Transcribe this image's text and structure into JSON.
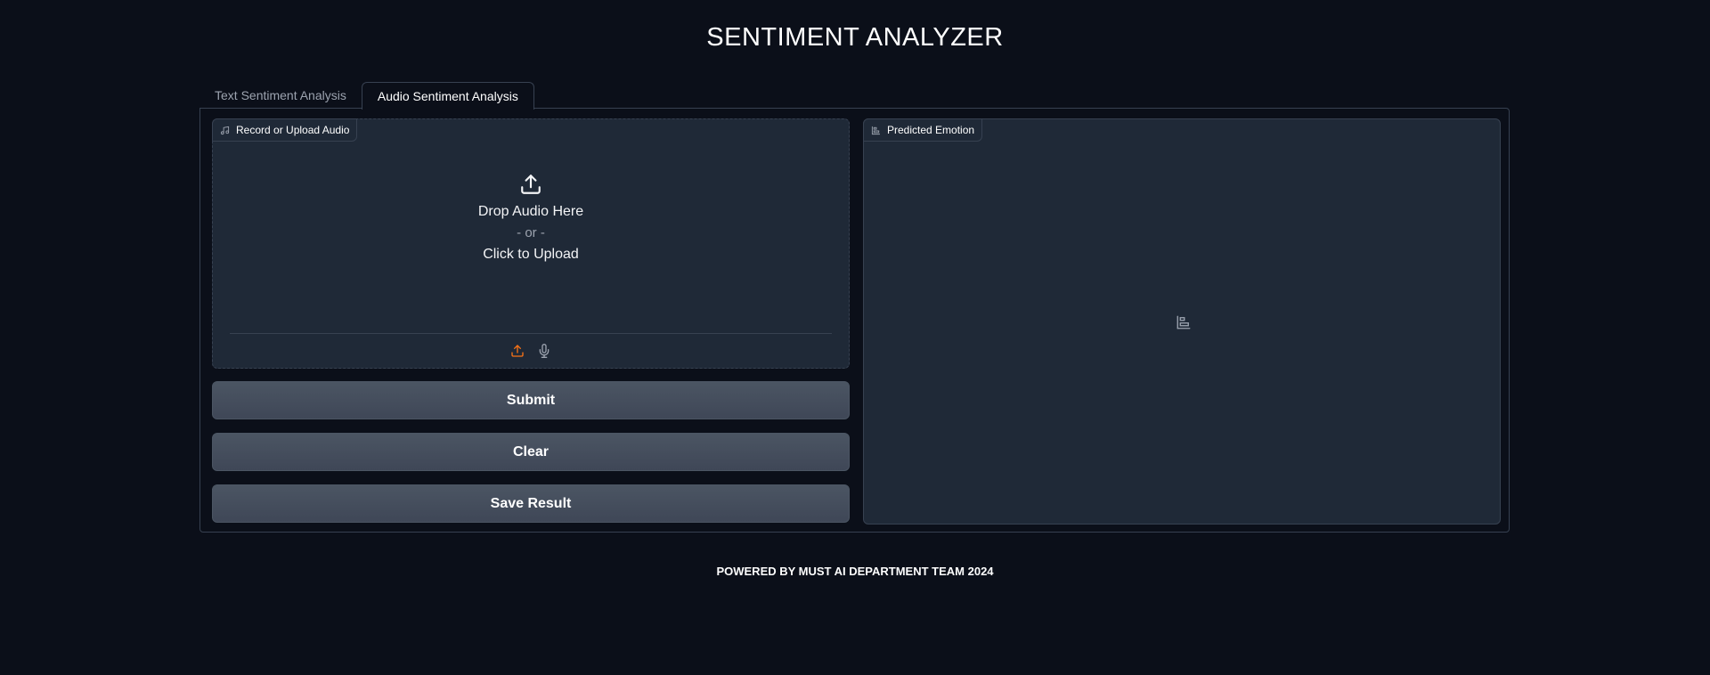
{
  "header": {
    "title": "SENTIMENT ANALYZER"
  },
  "tabs": [
    {
      "label": "Text Sentiment Analysis",
      "active": false
    },
    {
      "label": "Audio Sentiment Analysis",
      "active": true
    }
  ],
  "audio_input": {
    "label": "Record or Upload Audio",
    "label_icon": "music-note-icon",
    "upload_icon": "upload-icon",
    "drop_text": "Drop Audio Here",
    "or_text": "- or -",
    "click_text": "Click to Upload",
    "sources": [
      {
        "name": "upload",
        "icon": "upload-icon",
        "active": true
      },
      {
        "name": "microphone",
        "icon": "microphone-icon",
        "active": false
      }
    ]
  },
  "buttons": {
    "submit": "Submit",
    "clear": "Clear",
    "save": "Save Result"
  },
  "output": {
    "label": "Predicted Emotion",
    "label_icon": "bar-chart-icon",
    "empty_icon": "bar-chart-icon"
  },
  "footer": {
    "text": "POWERED BY MUST AI DEPARTMENT TEAM 2024"
  },
  "colors": {
    "background": "#0b0f19",
    "block": "#1f2937",
    "border": "#374151",
    "button": "#4b5563",
    "accent": "#f97316"
  }
}
